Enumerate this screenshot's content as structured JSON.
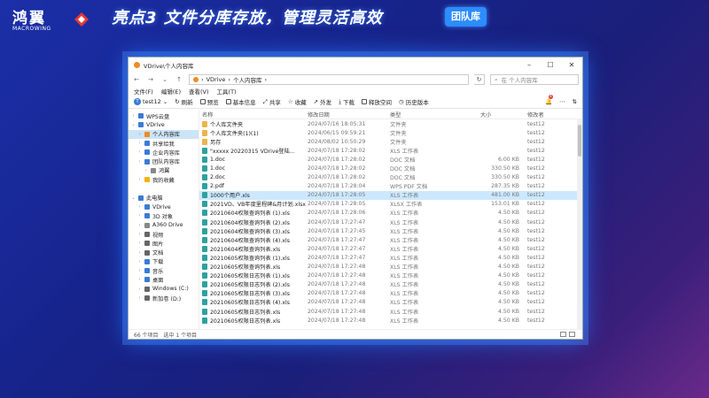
{
  "banner": {
    "logo_text": "鸿翼",
    "logo_sub": "MACROWING",
    "headline": "亮点3  文件分库存放，管理灵活高效",
    "badge": "团队库"
  },
  "window": {
    "title": "VDrive\\个人内容库",
    "breadcrumb": [
      "VDrive",
      "个人内容库"
    ],
    "search_placeholder": "在 个人内容库",
    "menu": [
      "文件(F)",
      "编辑(E)",
      "查看(V)",
      "工具(T)"
    ],
    "toolbar": {
      "user": "test12",
      "items": [
        "刷新",
        "预览",
        "基本信息",
        "共享",
        "收藏",
        "外发",
        "下载",
        "释放空间",
        "历史版本"
      ],
      "notifications": "4"
    },
    "sidebar": [
      {
        "label": "WPS云盘",
        "indent": 0,
        "color": "#3a7bd5"
      },
      {
        "label": "VDrive",
        "indent": 0,
        "color": "#3a7bd5",
        "expanded": true
      },
      {
        "label": "个人内容库",
        "indent": 1,
        "color": "#f08a24",
        "selected": true
      },
      {
        "label": "共享给我",
        "indent": 1,
        "color": "#3a7bd5"
      },
      {
        "label": "企业内容库",
        "indent": 1,
        "color": "#3a7bd5"
      },
      {
        "label": "团队内容库",
        "indent": 1,
        "color": "#3a7bd5"
      },
      {
        "label": "鸿翼",
        "indent": 2,
        "color": "#888888"
      },
      {
        "label": "我的收藏",
        "indent": 1,
        "color": "#f0b400"
      },
      {
        "label": "",
        "indent": 0,
        "color": ""
      },
      {
        "label": "此电脑",
        "indent": 0,
        "color": "#3a7bd5",
        "expanded": true
      },
      {
        "label": "VDrive",
        "indent": 1,
        "color": "#3a7bd5"
      },
      {
        "label": "3D 对象",
        "indent": 1,
        "color": "#3a7bd5"
      },
      {
        "label": "A360 Drive",
        "indent": 1,
        "color": "#888888"
      },
      {
        "label": "视频",
        "indent": 1,
        "color": "#666666"
      },
      {
        "label": "图片",
        "indent": 1,
        "color": "#666666"
      },
      {
        "label": "文档",
        "indent": 1,
        "color": "#666666"
      },
      {
        "label": "下载",
        "indent": 1,
        "color": "#3a7bd5"
      },
      {
        "label": "音乐",
        "indent": 1,
        "color": "#3a7bd5"
      },
      {
        "label": "桌面",
        "indent": 1,
        "color": "#3a7bd5"
      },
      {
        "label": "Windows (C:)",
        "indent": 1,
        "color": "#666666"
      },
      {
        "label": "新加卷 (D:)",
        "indent": 1,
        "color": "#666666"
      }
    ],
    "columns": [
      "名称",
      "修改日期",
      "类型",
      "大小",
      "修改者"
    ],
    "files": [
      {
        "name": "个人库文件夹",
        "date": "2024/07/16 18:05:31",
        "type": "文件夹",
        "size": "",
        "owner": "test12",
        "kind": "folder"
      },
      {
        "name": "个人库文件夹(1)(1)",
        "date": "2024/06/15 09:59:21",
        "type": "文件夹",
        "size": "",
        "owner": "test12",
        "kind": "folder"
      },
      {
        "name": "另存",
        "date": "2024/08/02 10:50:29",
        "type": "文件夹",
        "size": "",
        "owner": "test12",
        "kind": "folder"
      },
      {
        "name": "\"xxxxx   20220315   VDrive登陆...",
        "date": "2024/07/18 17:28:02",
        "type": "XLS 工作表",
        "size": "",
        "owner": "test12",
        "kind": "xls"
      },
      {
        "name": "1.doc",
        "date": "2024/07/18 17:28:02",
        "type": "DOC 文档",
        "size": "6.00 KB",
        "owner": "test12",
        "kind": "doc"
      },
      {
        "name": "1.doc",
        "date": "2024/07/18 17:28:02",
        "type": "DOC 文档",
        "size": "330.50 KB",
        "owner": "test12",
        "kind": "doc"
      },
      {
        "name": "2.doc",
        "date": "2024/07/18 17:28:02",
        "type": "DOC 文档",
        "size": "330.50 KB",
        "owner": "test12",
        "kind": "doc"
      },
      {
        "name": "2.pdf",
        "date": "2024/07/18 17:28:04",
        "type": "WPS PDF 文档",
        "size": "287.35 KB",
        "owner": "test12",
        "kind": "pdf"
      },
      {
        "name": "1000个用户.xls",
        "date": "2024/07/18 17:28:05",
        "type": "XLS 工作表",
        "size": "481.00 KB",
        "owner": "test12",
        "kind": "xls",
        "selected": true
      },
      {
        "name": "2021VD、VB年度里程碑&月计划.xlsx",
        "date": "2024/07/18 17:28:05",
        "type": "XLSX 工作表",
        "size": "153.01 KB",
        "owner": "test12",
        "kind": "xls"
      },
      {
        "name": "20210604权限查询列表 (1).xls",
        "date": "2024/07/18 17:28:06",
        "type": "XLS 工作表",
        "size": "4.50 KB",
        "owner": "test12",
        "kind": "xls"
      },
      {
        "name": "20210604权限查询列表 (2).xls",
        "date": "2024/07/18 17:27:47",
        "type": "XLS 工作表",
        "size": "4.50 KB",
        "owner": "test12",
        "kind": "xls"
      },
      {
        "name": "20210604权限查询列表 (3).xls",
        "date": "2024/07/18 17:27:45",
        "type": "XLS 工作表",
        "size": "4.50 KB",
        "owner": "test12",
        "kind": "xls"
      },
      {
        "name": "20210604权限查询列表 (4).xls",
        "date": "2024/07/18 17:27:47",
        "type": "XLS 工作表",
        "size": "4.50 KB",
        "owner": "test12",
        "kind": "xls"
      },
      {
        "name": "20210604权限查询列表.xls",
        "date": "2024/07/18 17:27:47",
        "type": "XLS 工作表",
        "size": "4.50 KB",
        "owner": "test12",
        "kind": "xls"
      },
      {
        "name": "20210605权限查询列表 (1).xls",
        "date": "2024/07/18 17:27:47",
        "type": "XLS 工作表",
        "size": "4.50 KB",
        "owner": "test12",
        "kind": "xls"
      },
      {
        "name": "20210605权限查询列表.xls",
        "date": "2024/07/18 17:27:48",
        "type": "XLS 工作表",
        "size": "4.50 KB",
        "owner": "test12",
        "kind": "xls"
      },
      {
        "name": "20210605权限日志列表 (1).xls",
        "date": "2024/07/18 17:27:48",
        "type": "XLS 工作表",
        "size": "4.50 KB",
        "owner": "test12",
        "kind": "xls"
      },
      {
        "name": "20210605权限日志列表 (2).xls",
        "date": "2024/07/18 17:27:48",
        "type": "XLS 工作表",
        "size": "4.50 KB",
        "owner": "test12",
        "kind": "xls"
      },
      {
        "name": "20210605权限日志列表 (3).xls",
        "date": "2024/07/18 17:27:48",
        "type": "XLS 工作表",
        "size": "4.50 KB",
        "owner": "test12",
        "kind": "xls"
      },
      {
        "name": "20210605权限日志列表 (4).xls",
        "date": "2024/07/18 17:27:48",
        "type": "XLS 工作表",
        "size": "4.50 KB",
        "owner": "test12",
        "kind": "xls"
      },
      {
        "name": "20210605权限日志列表.xls",
        "date": "2024/07/18 17:27:48",
        "type": "XLS 工作表",
        "size": "4.50 KB",
        "owner": "test12",
        "kind": "xls"
      },
      {
        "name": "20210605权限日志列表.xls",
        "date": "2024/07/18 17:27:48",
        "type": "XLS 工作表",
        "size": "4.50 KB",
        "owner": "test12",
        "kind": "xls"
      }
    ],
    "status": {
      "count": "66 个项目",
      "selected": "选中 1 个项目"
    }
  },
  "colors": {
    "folder": "#e8b64a",
    "xls": "#2fa0a0",
    "doc": "#2fa0a0",
    "pdf": "#2fa0a0",
    "accent": "#2d8cff"
  }
}
